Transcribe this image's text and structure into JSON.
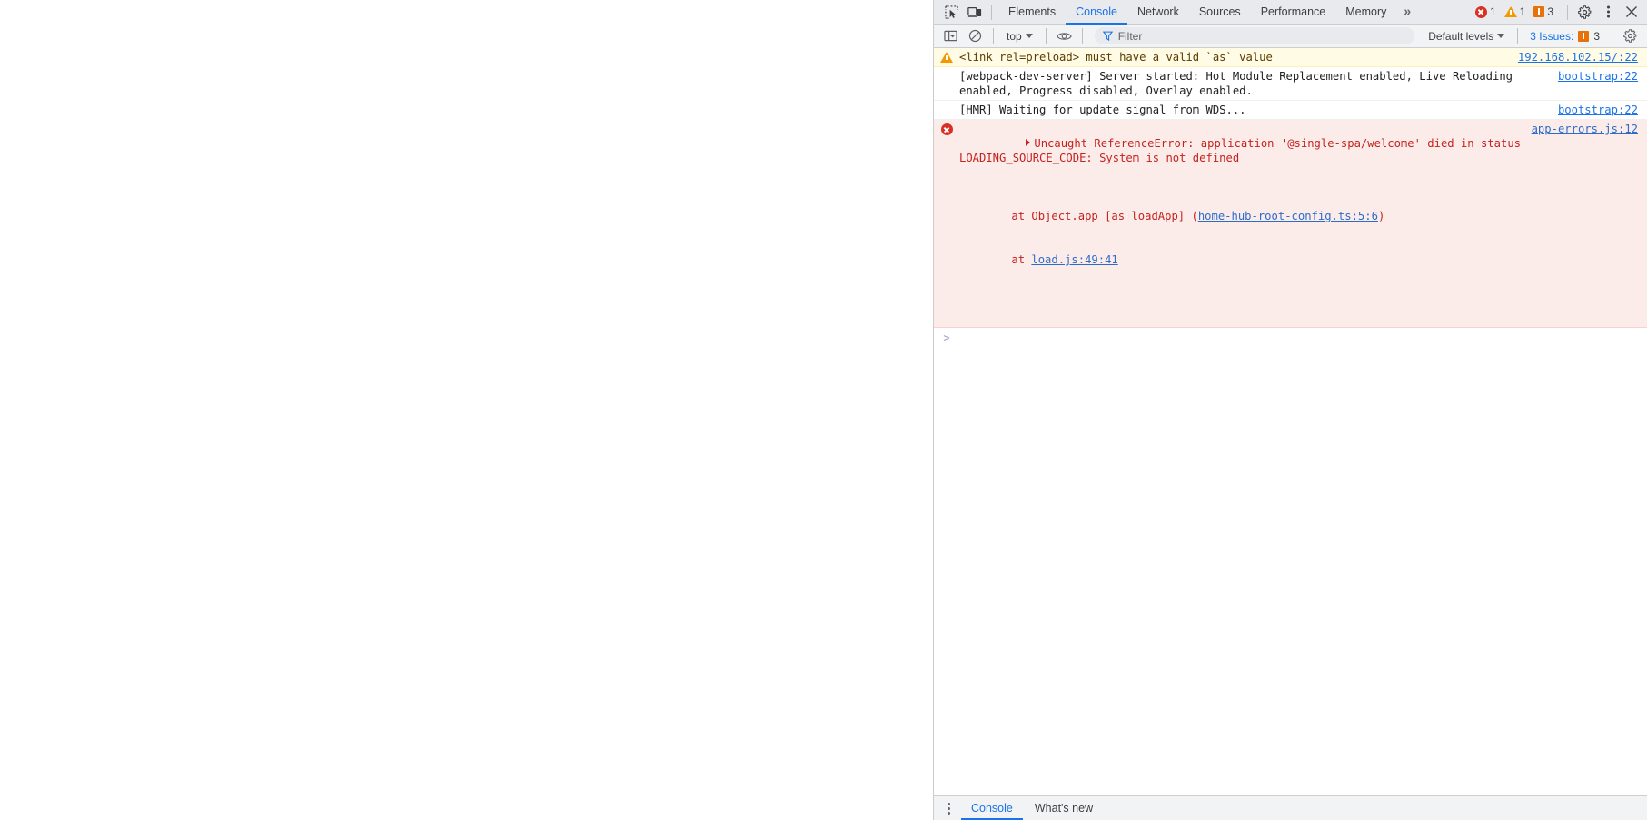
{
  "window": {
    "page_area_background": "#ffffff"
  },
  "devtools": {
    "accent_color": "#1a73e8",
    "tabbar": {
      "inspect_icon": "inspect-element-icon",
      "device_toolbar_icon": "device-toolbar-icon",
      "tabs": [
        {
          "label": "Elements",
          "active": false
        },
        {
          "label": "Console",
          "active": true
        },
        {
          "label": "Network",
          "active": false
        },
        {
          "label": "Sources",
          "active": false
        },
        {
          "label": "Performance",
          "active": false
        },
        {
          "label": "Memory",
          "active": false
        }
      ],
      "more_tabs_label": "»",
      "counters": {
        "errors": "1",
        "warnings": "1",
        "issues": "3"
      },
      "settings_icon": "gear-icon",
      "more_options_icon": "kebab-menu-icon",
      "close_icon": "close-icon"
    },
    "toolbar": {
      "sidebar_toggle_icon": "console-sidebar-icon",
      "clear_console_icon": "clear-console-icon",
      "context_selector": "top",
      "live_expression_icon": "eye-icon",
      "filter_icon": "filter-icon",
      "filter_placeholder": "Filter",
      "filter_value": "",
      "levels_selector": "Default levels",
      "issues_label": "3 Issues:",
      "issues_count": "3",
      "settings_icon": "gear-icon"
    },
    "console": {
      "prompt_symbol": ">",
      "messages": [
        {
          "level": "warning",
          "icon": "warning-icon",
          "text": "<link rel=preload> must have a valid `as` value",
          "source": "192.168.102.15/:22"
        },
        {
          "level": "info",
          "icon": "",
          "text": "[webpack-dev-server] Server started: Hot Module Replacement enabled, Live Reloading enabled, Progress disabled, Overlay enabled.",
          "source": "bootstrap:22"
        },
        {
          "level": "info",
          "icon": "",
          "text": "[HMR] Waiting for update signal from WDS...",
          "source": "bootstrap:22"
        },
        {
          "level": "error",
          "icon": "error-icon",
          "expandable": true,
          "text": "Uncaught ReferenceError: application '@single-spa/welcome' died in status LOADING_SOURCE_CODE: System is not defined",
          "stack": [
            {
              "prefix": "    at Object.app [as loadApp] (",
              "link": "home-hub-root-config.ts:5:6",
              "suffix": ")"
            },
            {
              "prefix": "    at ",
              "link": "load.js:49:41",
              "suffix": ""
            }
          ],
          "source": "app-errors.js:12"
        }
      ]
    },
    "drawer": {
      "more_tools_icon": "kebab-menu-icon",
      "tabs": [
        {
          "label": "Console",
          "active": true
        },
        {
          "label": "What's new",
          "active": false
        }
      ]
    }
  }
}
